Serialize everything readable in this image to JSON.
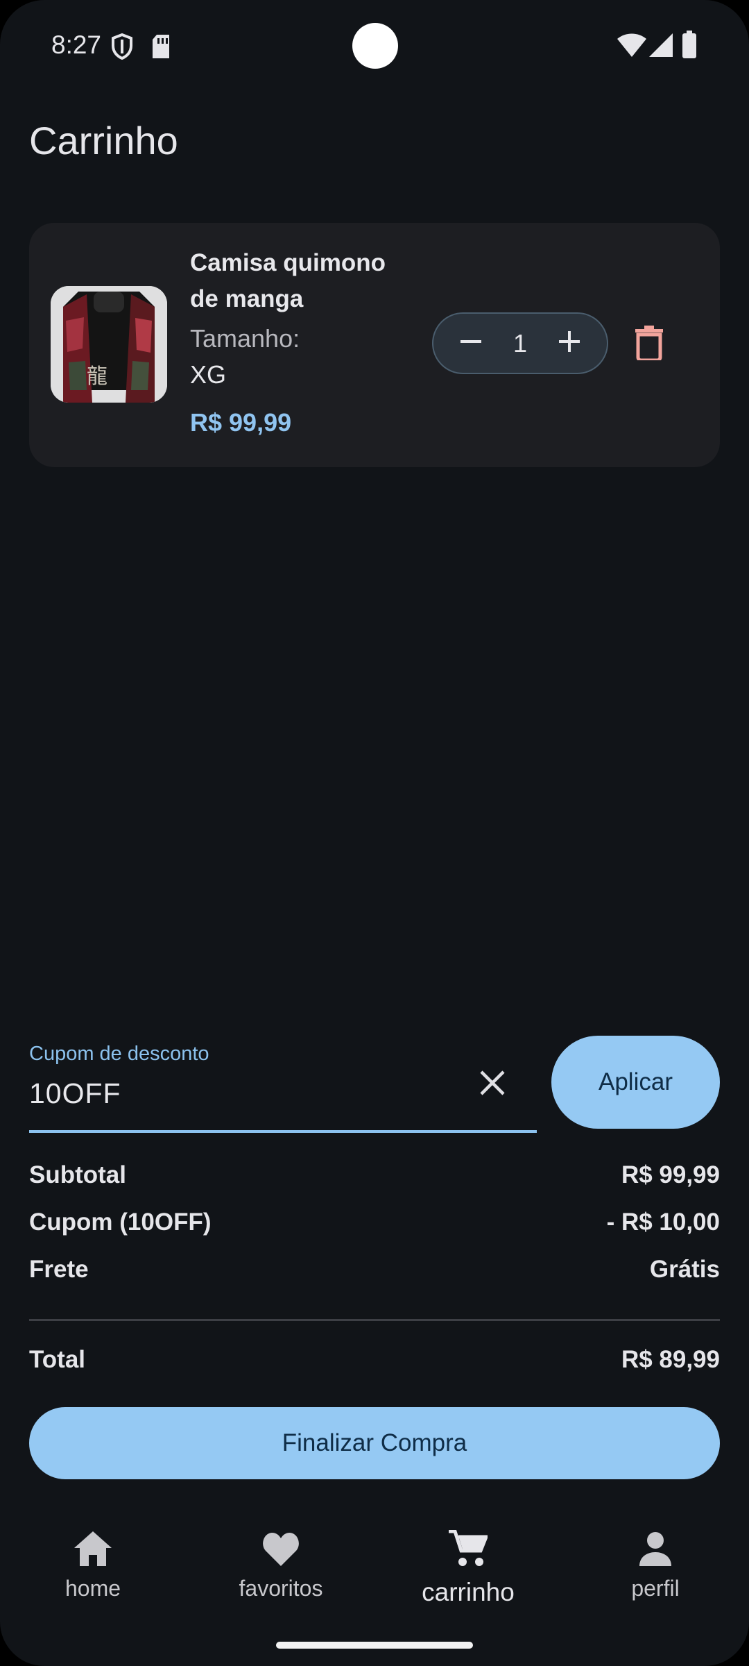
{
  "status_bar": {
    "time": "8:27"
  },
  "header": {
    "title": "Carrinho"
  },
  "cart": {
    "items": [
      {
        "name": "Camisa quimono de manga",
        "size_label": "Tamanho:",
        "size": "XG",
        "price": "R$ 99,99",
        "quantity": "1"
      }
    ]
  },
  "coupon": {
    "label": "Cupom de desconto",
    "value": "10OFF",
    "apply_label": "Aplicar"
  },
  "summary": {
    "subtotal_label": "Subtotal",
    "subtotal_value": "R$ 99,99",
    "coupon_label": "Cupom (10OFF)",
    "coupon_value": "- R$ 10,00",
    "shipping_label": "Frete",
    "shipping_value": "Grátis",
    "total_label": "Total",
    "total_value": "R$ 89,99"
  },
  "checkout_label": "Finalizar Compra",
  "nav": [
    {
      "label": "home",
      "icon": "home-icon"
    },
    {
      "label": "favoritos",
      "icon": "heart-icon"
    },
    {
      "label": "carrinho",
      "icon": "cart-icon",
      "active": true
    },
    {
      "label": "perfil",
      "icon": "person-icon"
    }
  ],
  "colors": {
    "background": "#111418",
    "card": "#1d1e22",
    "accent": "#95c9f3",
    "price": "#90c4f0",
    "delete": "#f2a49c"
  }
}
